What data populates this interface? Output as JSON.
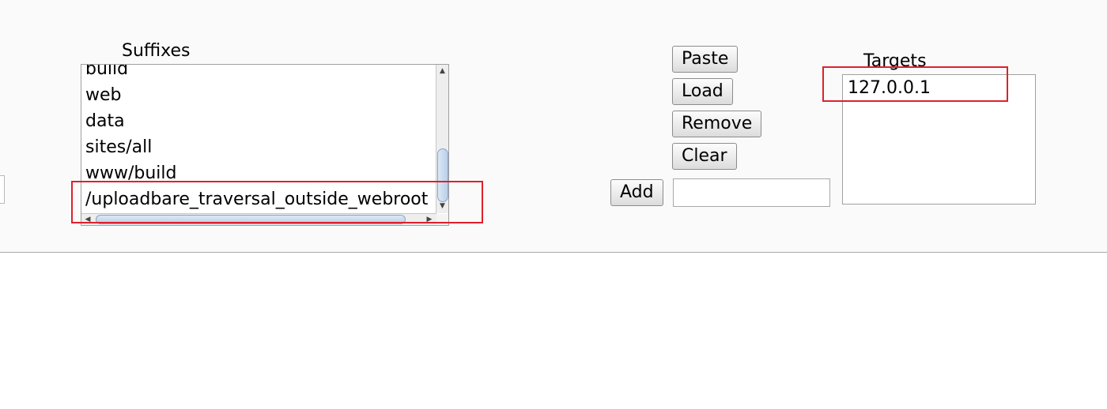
{
  "suffixes": {
    "label": "Suffixes",
    "items": [
      "build",
      "web",
      "data",
      "sites/all",
      "www/build",
      "/uploadbare_traversal_outside_webroot"
    ]
  },
  "actions": {
    "paste_label": "Paste",
    "load_label": "Load",
    "remove_label": "Remove",
    "clear_label": "Clear",
    "add_label": "Add",
    "add_input_value": ""
  },
  "targets": {
    "label": "Targets",
    "items": [
      "127.0.0.1"
    ]
  },
  "colors": {
    "highlight": "#e0202a",
    "scroll_thumb": "#b9cfe8"
  },
  "icons": {
    "scroll_up": "▲",
    "scroll_down": "▼",
    "scroll_left": "◀",
    "scroll_right": "▶"
  }
}
